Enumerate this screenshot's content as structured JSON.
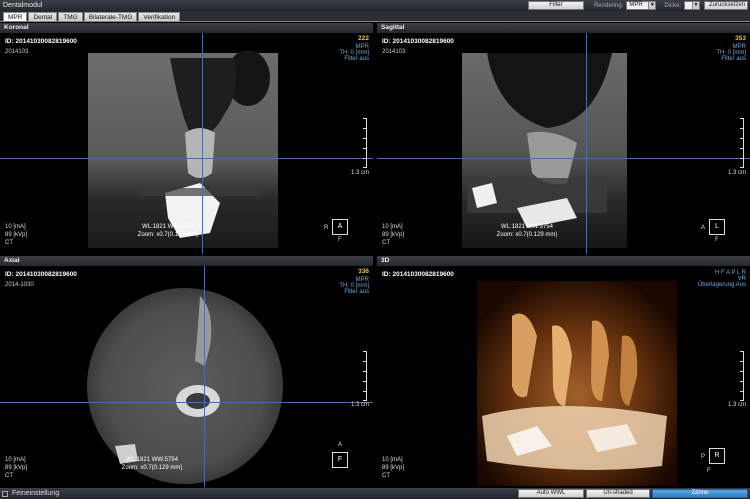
{
  "app": {
    "title": "Dentalmodul"
  },
  "toolbar": {
    "filter_label": "Filter",
    "rendering_label": "Rendering:",
    "rendering_value": "MPR",
    "thickness_label": "Dicke:",
    "thickness_value": "",
    "reset_label": "Zurücksetzen"
  },
  "tabs": [
    {
      "label": "MPR",
      "active": true
    },
    {
      "label": "Dental",
      "active": false
    },
    {
      "label": "TMG",
      "active": false
    },
    {
      "label": "Bilaterale-TMG",
      "active": false
    },
    {
      "label": "Verifikation",
      "active": false
    }
  ],
  "panels": {
    "coronal": {
      "title": "Koronal",
      "id": "ID: 20141030082819600",
      "date": "2014103",
      "slice": "222",
      "info": [
        "MPR",
        "TH: 0 [mm]",
        "Filter aus"
      ],
      "scale": "1.3 cm",
      "wl": "WL:1821 WW:5754",
      "zoom": "Zoom: x0.7(0.129 mm)",
      "tech": [
        "10 [mA]",
        "89 [kVp]",
        "CT"
      ],
      "orient_center": "A",
      "orient_left": "R",
      "orient_bottom": "F"
    },
    "sagittal": {
      "title": "Sagittal",
      "id": "ID: 20141030082819600",
      "date": "2014103",
      "slice": "353",
      "info": [
        "MPR",
        "TH: 0 [mm]",
        "Filter aus"
      ],
      "scale": "1.3 cm",
      "wl": "WL:1821 WW:5754",
      "zoom": "Zoom: x0.7(0.129 mm)",
      "tech": [
        "10 [mA]",
        "89 [kVp]",
        "CT"
      ],
      "orient_center": "L",
      "orient_left": "A",
      "orient_bottom": "F"
    },
    "axial": {
      "title": "Axial",
      "id": "ID: 20141030082819600",
      "date": "2014-1030",
      "slice": "336",
      "info": [
        "MPR",
        "TH: 0 [mm]",
        "Filter aus"
      ],
      "scale": "1.3 cm",
      "wl": "WL:1821 WW:5754",
      "zoom": "Zoom: x0.7(0.129 mm)",
      "tech": [
        "10 [mA]",
        "89 [kVp]",
        "CT"
      ],
      "orient_center": "F",
      "orient_top": "A"
    },
    "threed": {
      "title": "3D",
      "id": "ID: 20141030082819600",
      "info": [
        "H F A P L R",
        "VR",
        "Überlagerung Aus"
      ],
      "scale": "1.3 cm",
      "tech": [
        "10 [mA]",
        "89 [kVp]",
        "CT"
      ],
      "orient_center": "R",
      "orient_left": "P",
      "orient_bottom": "F"
    }
  },
  "bottom": {
    "fine_label": "Feineinstellung",
    "auto_wwl": "Auto WWL",
    "unshaded": "Un-shaded",
    "teeth": "Zähne"
  },
  "colors": {
    "crosshair": "#4a6fa8",
    "slice": "#e8c840",
    "info": "#6ea9d8",
    "accent": "#2f7fc4"
  }
}
